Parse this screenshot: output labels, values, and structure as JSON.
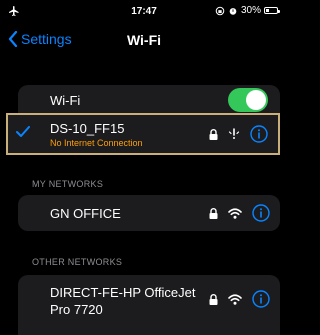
{
  "status_bar": {
    "time": "17:47",
    "battery_text": "30%",
    "battery_level": 0.3
  },
  "nav": {
    "back_label": "Settings",
    "title": "Wi-Fi"
  },
  "wifi_toggle": {
    "label": "Wi-Fi",
    "on": true
  },
  "connected_network": {
    "ssid": "DS-10_FF15",
    "status": "No Internet Connection",
    "secured": true
  },
  "my_networks": {
    "header": "MY NETWORKS",
    "items": [
      {
        "ssid": "GN OFFICE",
        "secured": true
      }
    ]
  },
  "other_networks": {
    "header": "OTHER NETWORKS",
    "items": [
      {
        "ssid": "DIRECT-FE-HP OfficeJet Pro 7720",
        "secured": true
      }
    ]
  },
  "colors": {
    "accent": "#0a84ff",
    "toggle_on": "#34c759",
    "warning": "#ff9f0a",
    "highlight_border": "#c9b07a"
  }
}
